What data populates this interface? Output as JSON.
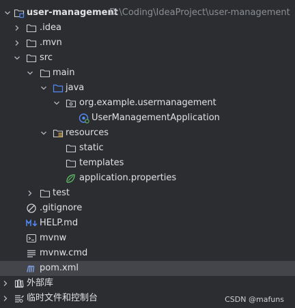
{
  "project": {
    "name": "user-management",
    "path": "D:\\Coding\\IdeaProject\\user-management"
  },
  "tree": {
    "idea": ".idea",
    "mvn": ".mvn",
    "src": "src",
    "main": "main",
    "java": "java",
    "package": "org.example.usermanagement",
    "app_class": "UserManagementApplication",
    "resources": "resources",
    "static": "static",
    "templates": "templates",
    "app_properties": "application.properties",
    "test": "test",
    "gitignore": ".gitignore",
    "help_md": "HELP.md",
    "mvnw": "mvnw",
    "mvnw_cmd": "mvnw.cmd",
    "pom_xml": "pom.xml"
  },
  "bottom": {
    "external_libraries": "外部库",
    "scratches": "临时文件和控制台"
  },
  "watermark": "CSDN @mafuns",
  "colors": {
    "background": "#2b2d30",
    "selected_row": "#43454a",
    "text": "#dfe1e5",
    "path_text": "#8c8f94",
    "folder_outline": "#ced0d6",
    "source_folder": "#548af7",
    "spring_green": "#5fb865"
  }
}
